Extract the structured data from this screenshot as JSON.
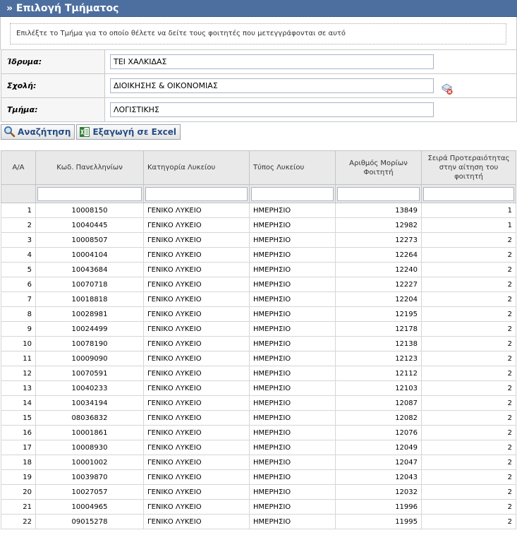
{
  "header": {
    "title": "» Επιλογή Τμήματος"
  },
  "instructions": "Επιλέξτε το Τμήμα για το οποίο θέλετε να δείτε τους φοιτητές που μετεγγράφονται σε αυτό",
  "form": {
    "institution": {
      "label": "Ίδρυμα:",
      "value": "ΤΕΙ ΧΑΛΚΙΔΑΣ"
    },
    "school": {
      "label": "Σχολή:",
      "value": "ΔΙΟΙΚΗΣΗΣ & ΟΙΚΟΝΟΜΙΑΣ"
    },
    "department": {
      "label": "Τμήμα:",
      "value": "ΛΟΓΙΣΤΙΚΗΣ"
    }
  },
  "toolbar": {
    "search_label": "Αναζήτηση",
    "export_label": "Εξαγωγή σε Excel"
  },
  "table": {
    "columns": [
      "Α/Α",
      "Κωδ. Πανελληνίων",
      "Κατηγορία Λυκείου",
      "Τύπος Λυκείου",
      "Αριθμός Μορίων Φοιτητή",
      "Σειρά Προτεραιότητας στην αίτηση του φοιτητή"
    ],
    "rows": [
      [
        "1",
        "10008150",
        "ΓΕΝΙΚΟ ΛΥΚΕΙΟ",
        "ΗΜΕΡΗΣΙΟ",
        "13849",
        "1"
      ],
      [
        "2",
        "10040445",
        "ΓΕΝΙΚΟ ΛΥΚΕΙΟ",
        "ΗΜΕΡΗΣΙΟ",
        "12982",
        "1"
      ],
      [
        "3",
        "10008507",
        "ΓΕΝΙΚΟ ΛΥΚΕΙΟ",
        "ΗΜΕΡΗΣΙΟ",
        "12273",
        "2"
      ],
      [
        "4",
        "10004104",
        "ΓΕΝΙΚΟ ΛΥΚΕΙΟ",
        "ΗΜΕΡΗΣΙΟ",
        "12264",
        "2"
      ],
      [
        "5",
        "10043684",
        "ΓΕΝΙΚΟ ΛΥΚΕΙΟ",
        "ΗΜΕΡΗΣΙΟ",
        "12240",
        "2"
      ],
      [
        "6",
        "10070718",
        "ΓΕΝΙΚΟ ΛΥΚΕΙΟ",
        "ΗΜΕΡΗΣΙΟ",
        "12227",
        "2"
      ],
      [
        "7",
        "10018818",
        "ΓΕΝΙΚΟ ΛΥΚΕΙΟ",
        "ΗΜΕΡΗΣΙΟ",
        "12204",
        "2"
      ],
      [
        "8",
        "10028981",
        "ΓΕΝΙΚΟ ΛΥΚΕΙΟ",
        "ΗΜΕΡΗΣΙΟ",
        "12195",
        "2"
      ],
      [
        "9",
        "10024499",
        "ΓΕΝΙΚΟ ΛΥΚΕΙΟ",
        "ΗΜΕΡΗΣΙΟ",
        "12178",
        "2"
      ],
      [
        "10",
        "10078190",
        "ΓΕΝΙΚΟ ΛΥΚΕΙΟ",
        "ΗΜΕΡΗΣΙΟ",
        "12138",
        "2"
      ],
      [
        "11",
        "10009090",
        "ΓΕΝΙΚΟ ΛΥΚΕΙΟ",
        "ΗΜΕΡΗΣΙΟ",
        "12123",
        "2"
      ],
      [
        "12",
        "10070591",
        "ΓΕΝΙΚΟ ΛΥΚΕΙΟ",
        "ΗΜΕΡΗΣΙΟ",
        "12112",
        "2"
      ],
      [
        "13",
        "10040233",
        "ΓΕΝΙΚΟ ΛΥΚΕΙΟ",
        "ΗΜΕΡΗΣΙΟ",
        "12103",
        "2"
      ],
      [
        "14",
        "10034194",
        "ΓΕΝΙΚΟ ΛΥΚΕΙΟ",
        "ΗΜΕΡΗΣΙΟ",
        "12087",
        "2"
      ],
      [
        "15",
        "08036832",
        "ΓΕΝΙΚΟ ΛΥΚΕΙΟ",
        "ΗΜΕΡΗΣΙΟ",
        "12082",
        "2"
      ],
      [
        "16",
        "10001861",
        "ΓΕΝΙΚΟ ΛΥΚΕΙΟ",
        "ΗΜΕΡΗΣΙΟ",
        "12076",
        "2"
      ],
      [
        "17",
        "10008930",
        "ΓΕΝΙΚΟ ΛΥΚΕΙΟ",
        "ΗΜΕΡΗΣΙΟ",
        "12049",
        "2"
      ],
      [
        "18",
        "10001002",
        "ΓΕΝΙΚΟ ΛΥΚΕΙΟ",
        "ΗΜΕΡΗΣΙΟ",
        "12047",
        "2"
      ],
      [
        "19",
        "10039870",
        "ΓΕΝΙΚΟ ΛΥΚΕΙΟ",
        "ΗΜΕΡΗΣΙΟ",
        "12043",
        "2"
      ],
      [
        "20",
        "10027057",
        "ΓΕΝΙΚΟ ΛΥΚΕΙΟ",
        "ΗΜΕΡΗΣΙΟ",
        "12032",
        "2"
      ],
      [
        "21",
        "10004965",
        "ΓΕΝΙΚΟ ΛΥΚΕΙΟ",
        "ΗΜΕΡΗΣΙΟ",
        "11996",
        "2"
      ],
      [
        "22",
        "09015278",
        "ΓΕΝΙΚΟ ΛΥΚΕΙΟ",
        "ΗΜΕΡΗΣΙΟ",
        "11995",
        "2"
      ]
    ]
  },
  "icons": {
    "search": "magnifier-icon",
    "export": "excel-icon",
    "clear": "clear-selection-icon"
  },
  "colors": {
    "titlebar": "#4d6fa0",
    "button_text": "#244b85",
    "header_bg": "#e9e9e9"
  }
}
